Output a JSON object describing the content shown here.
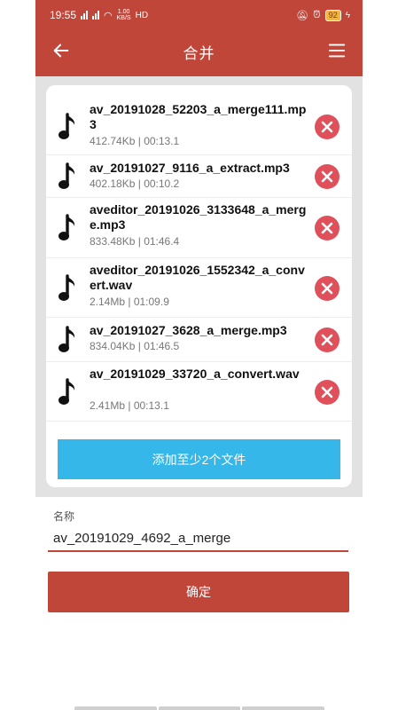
{
  "status_bar": {
    "time": "19:55",
    "network_speed_top": "1.00",
    "network_speed_bottom": "KB/S",
    "hd": "HD",
    "battery": "92"
  },
  "header": {
    "title": "合并",
    "back_icon": "arrow-left-icon",
    "menu_icon": "hamburger-menu-icon"
  },
  "files": [
    {
      "name": "av_20191028_52203_a_merge111.mp3",
      "size": "412.74Kb",
      "duration": "00:13.1"
    },
    {
      "name": "av_20191027_9116_a_extract.mp3",
      "size": "402.18Kb",
      "duration": "00:10.2"
    },
    {
      "name": "aveditor_20191026_3133648_a_merge.mp3",
      "size": "833.48Kb",
      "duration": "01:46.4"
    },
    {
      "name": "aveditor_20191026_1552342_a_convert.wav",
      "size": "2.14Mb",
      "duration": "01:09.9"
    },
    {
      "name": "av_20191027_3628_a_merge.mp3",
      "size": "834.04Kb",
      "duration": "01:46.5"
    },
    {
      "name": "av_20191029_33720_a_convert.wav",
      "size": "2.41Mb",
      "duration": "00:13.1"
    }
  ],
  "add_button_label": "添加至少2个文件",
  "name_label": "名称",
  "name_value": "av_20191029_4692_a_merge",
  "confirm_label": "确定",
  "colors": {
    "primary": "#c0463a",
    "accent_blue": "#35b7ea",
    "remove_red": "#e0505a"
  }
}
